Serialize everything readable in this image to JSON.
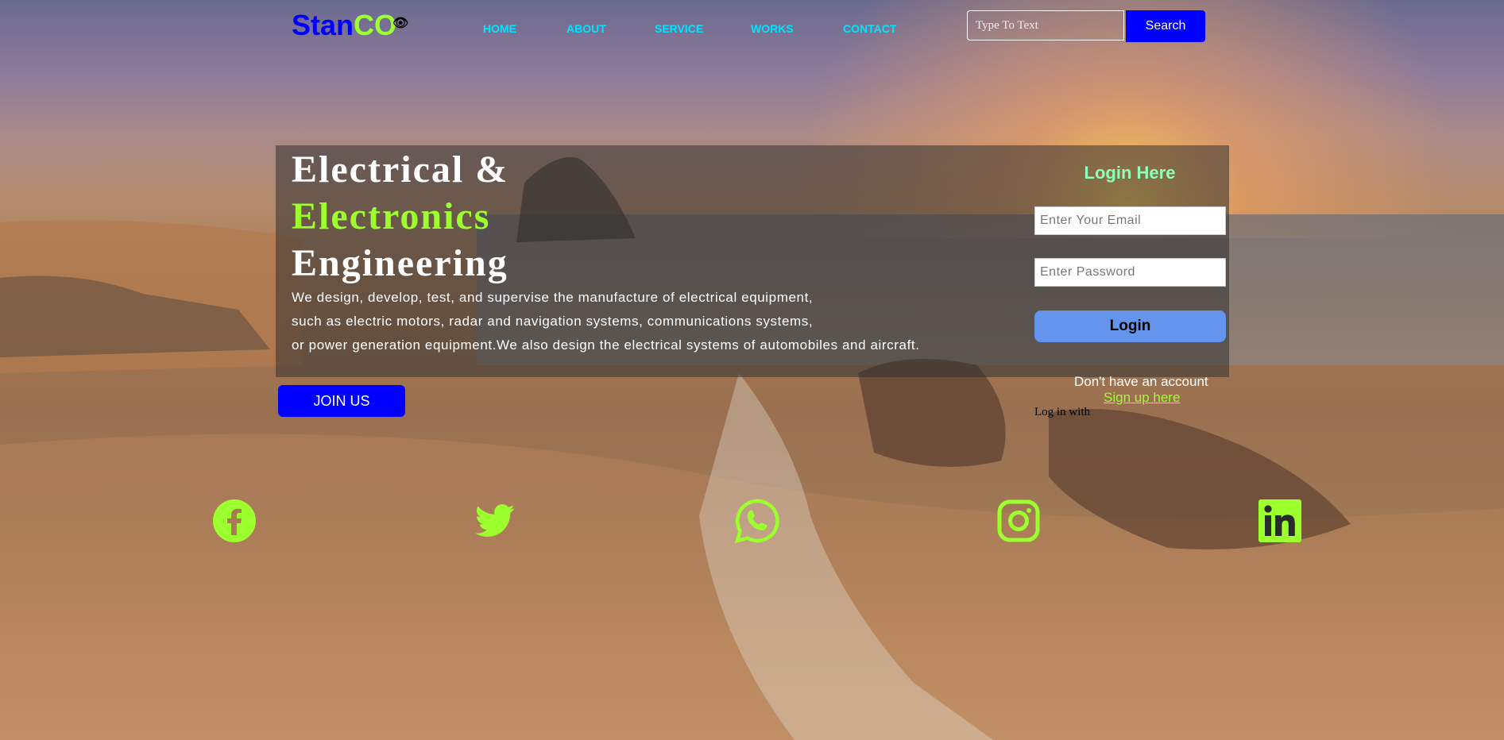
{
  "header": {
    "logo_stan": "Stan",
    "logo_co": "CO",
    "logo_icon": "eye-icon",
    "nav": [
      "HOME",
      "ABOUT",
      "SERVICE",
      "WORKS",
      "CONTACT"
    ],
    "search_placeholder": "Type To Text",
    "search_label": "Search"
  },
  "hero": {
    "line1": "Electrical &",
    "line2": "Electronics",
    "line3": "Engineering",
    "desc1": "We design, develop, test, and supervise the manufacture of electrical equipment,",
    "desc2": "such as electric motors, radar and navigation systems, communications systems,",
    "desc3": "or power generation equipment.We also design the electrical systems of automobiles and aircraft.",
    "join_label": "JOIN US"
  },
  "login": {
    "title": "Login Here",
    "email_placeholder": "Enter Your Email",
    "password_placeholder": "Enter Password",
    "button_label": "Login",
    "no_account": "Don't have an account",
    "signup_link": "Sign up here",
    "login_with": "Log in with"
  },
  "social": [
    "facebook-icon",
    "twitter-icon",
    "whatsapp-icon",
    "instagram-icon",
    "linkedin-icon"
  ],
  "colors": {
    "accent_green": "#9cff2e",
    "brand_blue": "#0000ff",
    "nav_cyan": "#00e5ff",
    "login_button": "#6495ed",
    "login_title": "#8fffba"
  }
}
